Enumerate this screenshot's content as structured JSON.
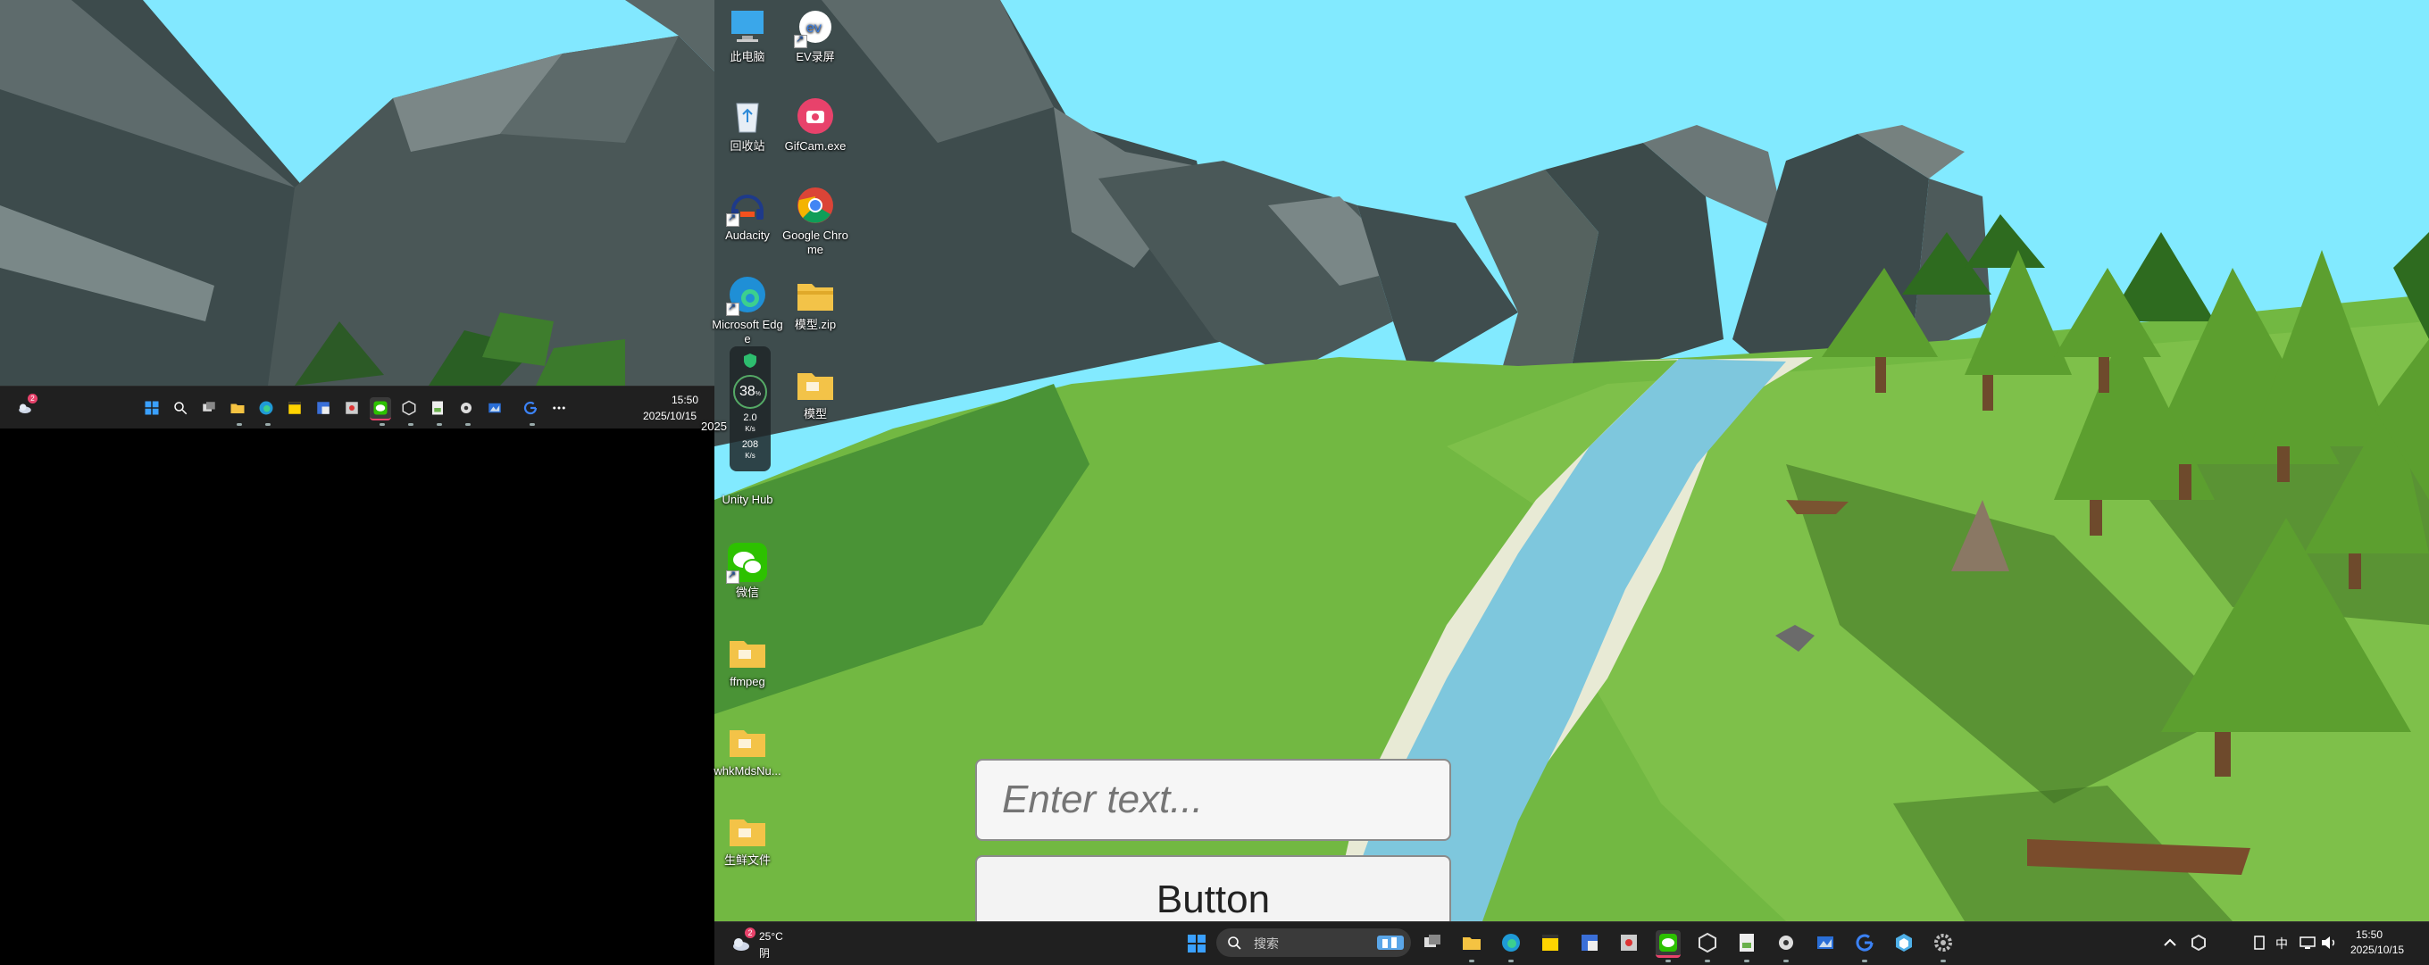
{
  "left_display": {
    "taskbar": {
      "clock_time": "15:50",
      "clock_date": "2025/10/15",
      "weather_badge": "2",
      "icons": [
        "start-icon",
        "search-icon",
        "task-view-icon",
        "file-explorer-icon",
        "edge-icon",
        "sticky-notes-icon",
        "app-icon",
        "app-icon",
        "wechat-icon",
        "unity-icon",
        "app-icon",
        "app-icon",
        "app-icon",
        "app-icon",
        "g-app-icon",
        "more-icon"
      ]
    }
  },
  "desktop_icons": [
    {
      "label": "此电脑",
      "icon": "computer-icon"
    },
    {
      "label": "EV录屏",
      "icon": "ev-recorder-icon"
    },
    {
      "label": "回收站",
      "icon": "recycle-bin-icon"
    },
    {
      "label": "GifCam.exe",
      "icon": "gifcam-icon"
    },
    {
      "label": "Audacity",
      "icon": "audacity-icon"
    },
    {
      "label": "Google Chrome",
      "icon": "chrome-icon"
    },
    {
      "label": "Microsoft Edge",
      "icon": "edge-icon"
    },
    {
      "label": "模型.zip",
      "icon": "zip-folder-icon"
    },
    {
      "label": "2025",
      "icon": "folder-icon"
    },
    {
      "label": "模型",
      "icon": "folder-icon"
    },
    {
      "label": "Unity Hub",
      "icon": "unity-hub-icon"
    },
    {
      "label": "微信",
      "icon": "wechat-icon"
    },
    {
      "label": "ffmpeg",
      "icon": "folder-icon"
    },
    {
      "label": "whkMdsNu...",
      "icon": "folder-icon"
    },
    {
      "label": "生鲜文件",
      "icon": "folder-icon"
    }
  ],
  "perf_widget": {
    "cpu": "38",
    "cpu_unit": "%",
    "up": "2.0",
    "up_unit": "K/s",
    "down": "208",
    "down_unit": "K/s"
  },
  "game_ui": {
    "input_placeholder": "Enter text...",
    "button_label": "Button"
  },
  "taskbar": {
    "weather_temp": "25°C",
    "weather_desc": "阴",
    "weather_badge": "2",
    "search_placeholder": "搜索",
    "tray_lang": "中",
    "clock_time": "15:50",
    "clock_date": "2025/10/15"
  },
  "colors": {
    "sky": "#82eaff",
    "grass": "#72b842",
    "river": "#7ec7dd",
    "taskbar": "#202020",
    "accent": "#e8426b"
  }
}
